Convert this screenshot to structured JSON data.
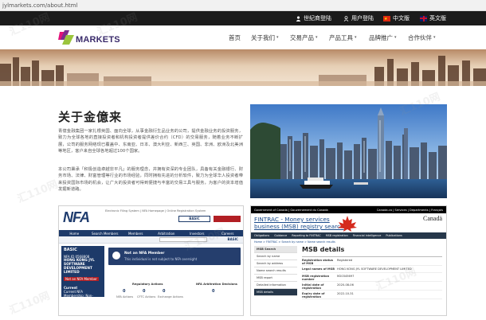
{
  "browser": {
    "url": "jylmarkets.com/about.html"
  },
  "topbar": {
    "links": [
      {
        "label": "世纪商登陆",
        "icon": "user-icon"
      },
      {
        "label": "用户登陆",
        "icon": "user-icon"
      },
      {
        "label": "中文版",
        "icon": "china-flag-icon"
      },
      {
        "label": "英文版",
        "icon": "uk-flag-icon"
      }
    ]
  },
  "logo": {
    "text": "MARKETS"
  },
  "nav": {
    "items": [
      {
        "label": "首页",
        "has_menu": false
      },
      {
        "label": "关于我们",
        "has_menu": true
      },
      {
        "label": "交易产品",
        "has_menu": true
      },
      {
        "label": "产品工具",
        "has_menu": true
      },
      {
        "label": "品牌推广",
        "has_menu": true
      },
      {
        "label": "合作伙伴",
        "has_menu": true
      }
    ],
    "caret": "▾"
  },
  "about": {
    "title": "关于金億来",
    "paragraphs": [
      "青億金融集团一家扎根英国、面向全球，从事金融衍生品业务的公司，提供金融业务的投资服务，致力为全球各地的直接投资者和机构投资者提供差价合约（CFD）的交易服务，随着业务不断扩展，公司的服务网络现已覆盖中、东南亚、日本、澳大利亚、新西兰、英国、非洲、欧洲及北美洲等地区，客户来自全球各地超过100个国家。",
      "本公司秉承「积极创造卓越非平凡」的服务理念，并拥有资深的专业团队，具备有关金融银行、财务市场、法律、财富管理等行业的市场经验，同时拥有先进的分析软件，致力为全球华人投资者带来投资国际市场的机会，让广大的投资者可得到便捷与丰富的交易工具与服务，为客户的资本增值发掘新道路。"
    ]
  },
  "nfa": {
    "logo": "NFA",
    "top_links": "Electronic Filing System | NFA Homepage | Online Registration System",
    "search_label": "BASIC",
    "menu": [
      "Home",
      "Search Members",
      "Members",
      "Arbitration",
      "Investors",
      "Careers"
    ],
    "side": {
      "label": "BASIC",
      "id": "NFA ID 0568808",
      "name": "HONG KONG JYL SOFTWARE DEVELOPMENT LIMITED",
      "status": "Not an NFA Member",
      "current": "Current",
      "non_member": "Current NFA Membership: Non-member"
    },
    "card": {
      "title": "Not an NFA Member",
      "sub": "This individual is not subject to NFA oversight"
    },
    "stats": {
      "reg_label": "Regulatory Actions",
      "values": [
        "0",
        "0",
        "0"
      ],
      "cols": [
        "NFA Actions",
        "CFTC Actions",
        "Exchange Actions"
      ],
      "arb_label": "NFA Arbitration Decisions",
      "arb_value": "0"
    }
  },
  "fintrac": {
    "top_left": "Government of Canada | Gouvernement du Canada",
    "top_right": "Canada.ca | Services | Departments | Français",
    "title_line1": "FINTRAC - Money services",
    "title_line2": "business (MSB) registry search",
    "canada": "Canadä",
    "menu": [
      "Obligations",
      "Guidance",
      "Reporting to FINTRAC",
      "MSB registration",
      "Financial intelligence",
      "Publications"
    ],
    "breadcrumb": "Home > FINTRAC > Search by name > Name search results",
    "side": {
      "header": "MSB Search",
      "items": [
        "Search by name",
        "Search by address",
        "Name search results",
        "MSB report",
        "Detailed information"
      ],
      "selected": "MSB details"
    },
    "details": {
      "heading": "MSB details",
      "rows": [
        {
          "k": "Registration status of MSB",
          "v": "Registered"
        },
        {
          "k": "Legal names of MSB",
          "v": "HONG KONG JYL SOFTWARE DEVELOPMENT LIMITED"
        },
        {
          "k": "MSB registration number",
          "v": "M20345697"
        },
        {
          "k": "Initial date of registration",
          "v": "2020-08-06"
        },
        {
          "k": "Expiry date of registration",
          "v": "2022-10-31"
        }
      ]
    }
  },
  "watermark": "汇110网"
}
